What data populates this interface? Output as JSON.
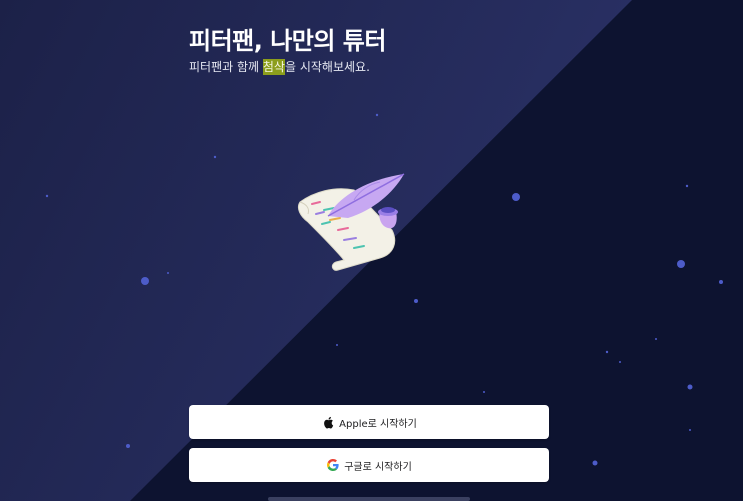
{
  "header": {
    "title": "피터팬, 나만의 튜터",
    "subtitle_before": "피터팬과 함께 ",
    "subtitle_highlight": "첨삭",
    "subtitle_after": "을 시작해보세요."
  },
  "buttons": {
    "apple_label": "Apple로 시작하기",
    "google_label": "구글로 시작하기"
  },
  "colors": {
    "background_dark": "#0e1430",
    "background_light": "#262d5c",
    "highlight": "#8c9e1c",
    "star": "#4a5ac8"
  },
  "icons": [
    "apple-icon",
    "google-icon",
    "quill-scroll-illustration"
  ]
}
